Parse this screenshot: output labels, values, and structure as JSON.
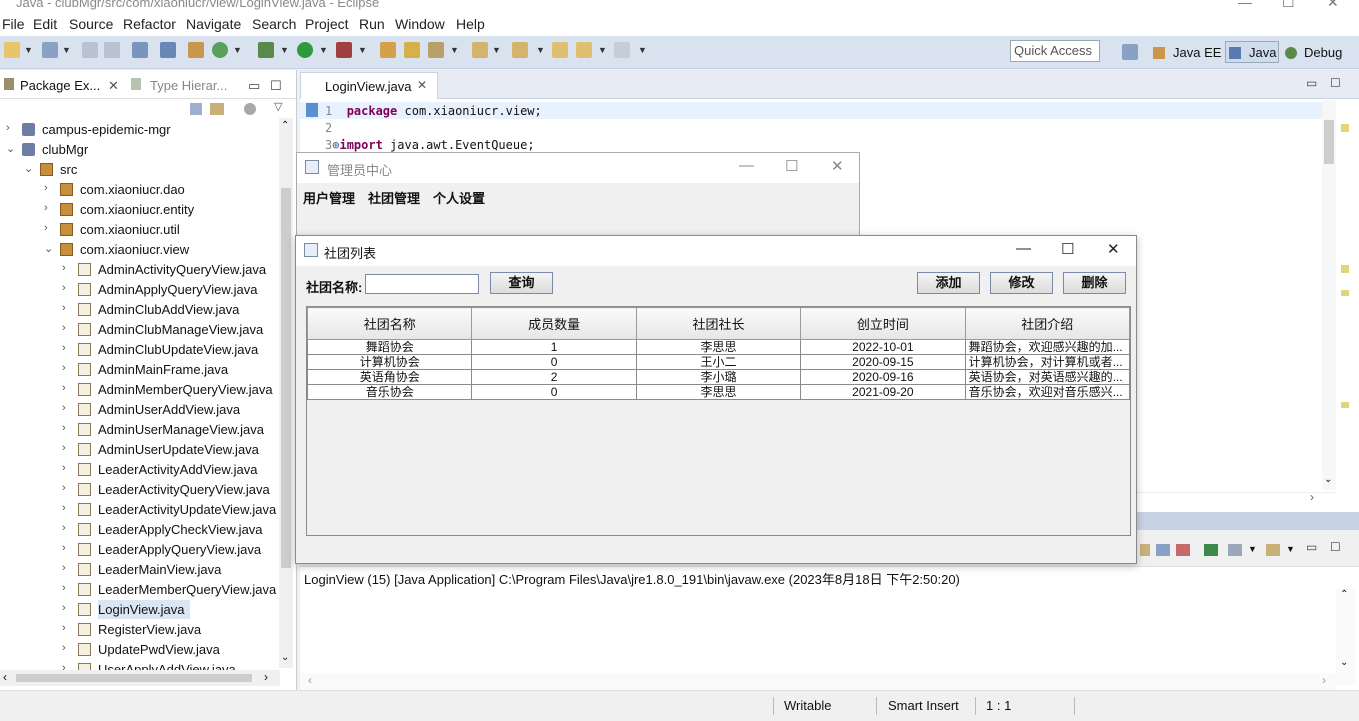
{
  "window": {
    "title": "Java - clubMgr/src/com/xiaoniucr/view/LoginView.java - Eclipse"
  },
  "menubar": [
    "File",
    "Edit",
    "Source",
    "Refactor",
    "Navigate",
    "Search",
    "Project",
    "Run",
    "Window",
    "Help"
  ],
  "toolbar": {
    "quick_access": "Quick Access",
    "perspectives": [
      "Java EE",
      "Java",
      "Debug"
    ]
  },
  "left_panel": {
    "tabs": [
      "Package Ex...",
      "Type Hierar..."
    ],
    "tree": [
      {
        "label": "campus-epidemic-mgr",
        "level": 0,
        "kind": "project",
        "expanded": false
      },
      {
        "label": "clubMgr",
        "level": 0,
        "kind": "project",
        "expanded": true
      },
      {
        "label": "src",
        "level": 1,
        "kind": "src",
        "expanded": true
      },
      {
        "label": "com.xiaoniucr.dao",
        "level": 2,
        "kind": "package",
        "expanded": false
      },
      {
        "label": "com.xiaoniucr.entity",
        "level": 2,
        "kind": "package",
        "expanded": false
      },
      {
        "label": "com.xiaoniucr.util",
        "level": 2,
        "kind": "package",
        "expanded": false
      },
      {
        "label": "com.xiaoniucr.view",
        "level": 2,
        "kind": "package",
        "expanded": true
      },
      {
        "label": "AdminActivityQueryView.java",
        "level": 3,
        "kind": "file"
      },
      {
        "label": "AdminApplyQueryView.java",
        "level": 3,
        "kind": "file"
      },
      {
        "label": "AdminClubAddView.java",
        "level": 3,
        "kind": "file"
      },
      {
        "label": "AdminClubManageView.java",
        "level": 3,
        "kind": "file"
      },
      {
        "label": "AdminClubUpdateView.java",
        "level": 3,
        "kind": "file"
      },
      {
        "label": "AdminMainFrame.java",
        "level": 3,
        "kind": "file"
      },
      {
        "label": "AdminMemberQueryView.java",
        "level": 3,
        "kind": "file"
      },
      {
        "label": "AdminUserAddView.java",
        "level": 3,
        "kind": "file"
      },
      {
        "label": "AdminUserManageView.java",
        "level": 3,
        "kind": "file"
      },
      {
        "label": "AdminUserUpdateView.java",
        "level": 3,
        "kind": "file"
      },
      {
        "label": "LeaderActivityAddView.java",
        "level": 3,
        "kind": "file"
      },
      {
        "label": "LeaderActivityQueryView.java",
        "level": 3,
        "kind": "file"
      },
      {
        "label": "LeaderActivityUpdateView.java",
        "level": 3,
        "kind": "file"
      },
      {
        "label": "LeaderApplyCheckView.java",
        "level": 3,
        "kind": "file"
      },
      {
        "label": "LeaderApplyQueryView.java",
        "level": 3,
        "kind": "file"
      },
      {
        "label": "LeaderMainView.java",
        "level": 3,
        "kind": "file"
      },
      {
        "label": "LeaderMemberQueryView.java",
        "level": 3,
        "kind": "file"
      },
      {
        "label": "LoginView.java",
        "level": 3,
        "kind": "file",
        "selected": true
      },
      {
        "label": "RegisterView.java",
        "level": 3,
        "kind": "file"
      },
      {
        "label": "UpdatePwdView.java",
        "level": 3,
        "kind": "file"
      },
      {
        "label": "UserApplyAddView.java",
        "level": 3,
        "kind": "file"
      }
    ]
  },
  "editor": {
    "tab": "LoginView.java",
    "lines": [
      {
        "num": "1",
        "kw": "package",
        "rest": " com.xiaoniucr.view;"
      },
      {
        "num": "2",
        "kw": "",
        "rest": ""
      },
      {
        "num": "3",
        "kw": "import",
        "rest": " java.awt.EventQueue;"
      }
    ]
  },
  "console": {
    "header": "LoginView (15) [Java Application] C:\\Program Files\\Java\\jre1.8.0_191\\bin\\javaw.exe (2023年8月18日 下午2:50:20)"
  },
  "statusbar": {
    "writable": "Writable",
    "insert": "Smart Insert",
    "position": "1 : 1"
  },
  "admin_window": {
    "title": "管理员中心",
    "menus": [
      "用户管理",
      "社团管理",
      "个人设置"
    ]
  },
  "club_window": {
    "title": "社团列表",
    "search_label": "社团名称:",
    "search_value": "",
    "buttons": {
      "query": "查询",
      "add": "添加",
      "edit": "修改",
      "delete": "删除"
    },
    "table": {
      "headers": [
        "社团名称",
        "成员数量",
        "社团社长",
        "创立时间",
        "社团介绍"
      ],
      "rows": [
        [
          "舞蹈协会",
          "1",
          "李思思",
          "2022-10-01",
          "舞蹈协会，欢迎感兴趣的加..."
        ],
        [
          "计算机协会",
          "0",
          "王小二",
          "2020-09-15",
          "计算机协会，对计算机或者..."
        ],
        [
          "英语角协会",
          "2",
          "李小璐",
          "2020-09-16",
          "英语协会，对英语感兴趣的..."
        ],
        [
          "音乐协会",
          "0",
          "李思思",
          "2021-09-20",
          "音乐协会，欢迎对音乐感兴..."
        ]
      ]
    }
  }
}
